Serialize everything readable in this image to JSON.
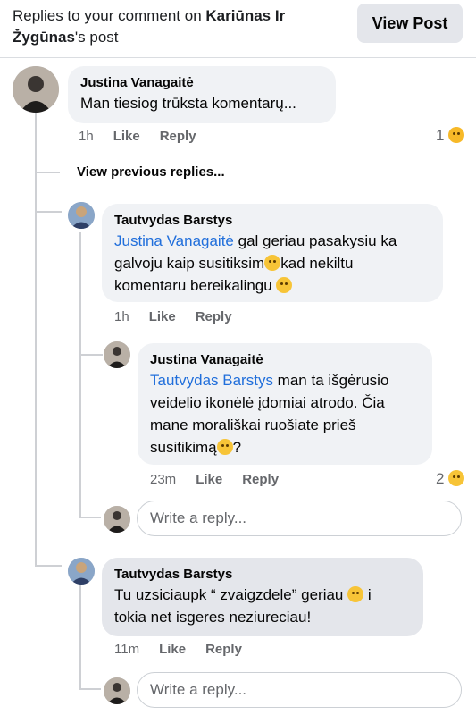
{
  "header": {
    "prefix": "Replies to your comment on ",
    "post_owner": "Kariūnas Ir Žygūnas",
    "suffix": "'s post",
    "view_post_label": "View Post"
  },
  "comments": [
    {
      "author": "Justina Vanagaitė",
      "text": "Man tiesiog trūksta komentarų...",
      "time": "1h",
      "like": "Like",
      "reply": "Reply",
      "reaction_count": "1",
      "reaction_icon": "hug-emoji-icon"
    },
    {
      "author": "Tautvydas Barstys",
      "mention": "Justina Vanagaitė",
      "text_1": " gal geriau pasakysiu ka",
      "text_2": "galvoju kaip susitiksim",
      "text_2b": "kad nekiltu",
      "text_3": "komentaru bereikalingu",
      "time": "1h",
      "like": "Like",
      "reply": "Reply"
    },
    {
      "author": "Justina Vanagaitė",
      "mention": "Tautvydas Barstys",
      "text_1": " man ta išgėrusio",
      "text_2": "veidelio ikonėlė įdomiai atrodo. Čia",
      "text_3": "mane morališkai ruošiate prieš",
      "text_4": "susitikimą",
      "text_4b": "?",
      "time": "23m",
      "like": "Like",
      "reply": "Reply",
      "reaction_count": "2",
      "reaction_icon": "laugh-emoji-icon"
    },
    {
      "author": "Tautvydas Barstys",
      "text_1": "Tu uzsiciaupk “ zvaigzdele” geriau",
      "text_1b": "i",
      "text_2": "tokia net isgeres neziureciau!",
      "time": "11m",
      "like": "Like",
      "reply": "Reply"
    }
  ],
  "view_previous": "View previous replies...",
  "write_reply_placeholder": "Write a reply..."
}
